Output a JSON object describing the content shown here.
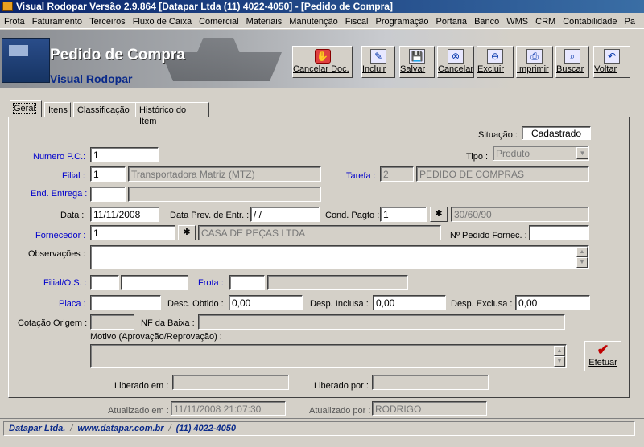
{
  "window": {
    "title": "Visual Rodopar Versão 2.9.864 [Datapar Ltda (11) 4022-4050]  - [Pedido de Compra]"
  },
  "menu": [
    "Frota",
    "Faturamento",
    "Terceiros",
    "Fluxo de Caixa",
    "Comercial",
    "Materiais",
    "Manutenção",
    "Fiscal",
    "Programação",
    "Portaria",
    "Banco",
    "WMS",
    "CRM",
    "Contabilidade",
    "Pa"
  ],
  "banner": {
    "title": "Pedido de Compra",
    "subtitle": "Visual Rodopar"
  },
  "toolbar": {
    "cancelar_doc": "Cancelar Doc.",
    "incluir": "Incluir",
    "salvar": "Salvar",
    "cancelar": "Cancelar",
    "excluir": "Excluir",
    "imprimir": "Imprimir",
    "buscar": "Buscar",
    "voltar": "Voltar"
  },
  "tabs": [
    "Geral",
    "Itens",
    "Classificação",
    "Histórico do Item"
  ],
  "form": {
    "situacao_label": "Situação :",
    "situacao": "Cadastrado",
    "numero_pc_label": "Numero P.C.:",
    "numero_pc": "1",
    "tipo_label": "Tipo :",
    "tipo": "Produto",
    "filial_label": "Filial :",
    "filial_code": "1",
    "filial_name": "Transportadora Matriz (MTZ)",
    "tarefa_label": "Tarefa :",
    "tarefa_code": "2",
    "tarefa_name": "PEDIDO DE COMPRAS",
    "end_entrega_label": "End. Entrega :",
    "end_entrega_code": "",
    "end_entrega_desc": "",
    "data_label": "Data :",
    "data": "11/11/2008",
    "data_prev_label": "Data Prev. de Entr. :",
    "data_prev": " / /",
    "cond_pagto_label": "Cond. Pagto :",
    "cond_pagto_code": "1",
    "cond_pagto_desc": "30/60/90",
    "fornecedor_label": "Fornecedor :",
    "fornecedor_code": "1",
    "fornecedor_name": "CASA DE PEÇAS LTDA",
    "pedido_fornec_label": "Nº Pedido Fornec. :",
    "pedido_fornec": "",
    "observacoes_label": "Observações :",
    "observacoes": "",
    "filial_os_label": "Filial/O.S. :",
    "filial_os_1": "",
    "filial_os_2": "",
    "frota_label": "Frota :",
    "frota_code": "",
    "frota_desc": "",
    "placa_label": "Placa :",
    "placa": "",
    "desc_obtido_label": "Desc. Obtido :",
    "desc_obtido": "0,00",
    "desp_inclusa_label": "Desp. Inclusa :",
    "desp_inclusa": "0,00",
    "desp_exclusa_label": "Desp. Exclusa :",
    "desp_exclusa": "0,00",
    "cotacao_origem_label": "Cotação Origem :",
    "cotacao_origem": "",
    "nf_baixa_label": "NF da Baixa :",
    "nf_baixa": "",
    "motivo_label": "Motivo (Aprovação/Reprovação) :",
    "motivo": "",
    "efetuar": "Efetuar",
    "liberado_em_label": "Liberado em :",
    "liberado_em": "",
    "liberado_por_label": "Liberado por :",
    "liberado_por": "",
    "atualizado_em_label": "Atualizado em :",
    "atualizado_em": "11/11/2008 21:07:30",
    "atualizado_por_label": "Atualizado por :",
    "atualizado_por": "RODRIGO"
  },
  "status": {
    "company": "Datapar Ltda.",
    "site": "www.datapar.com.br",
    "phone": "(11) 4022-4050"
  }
}
